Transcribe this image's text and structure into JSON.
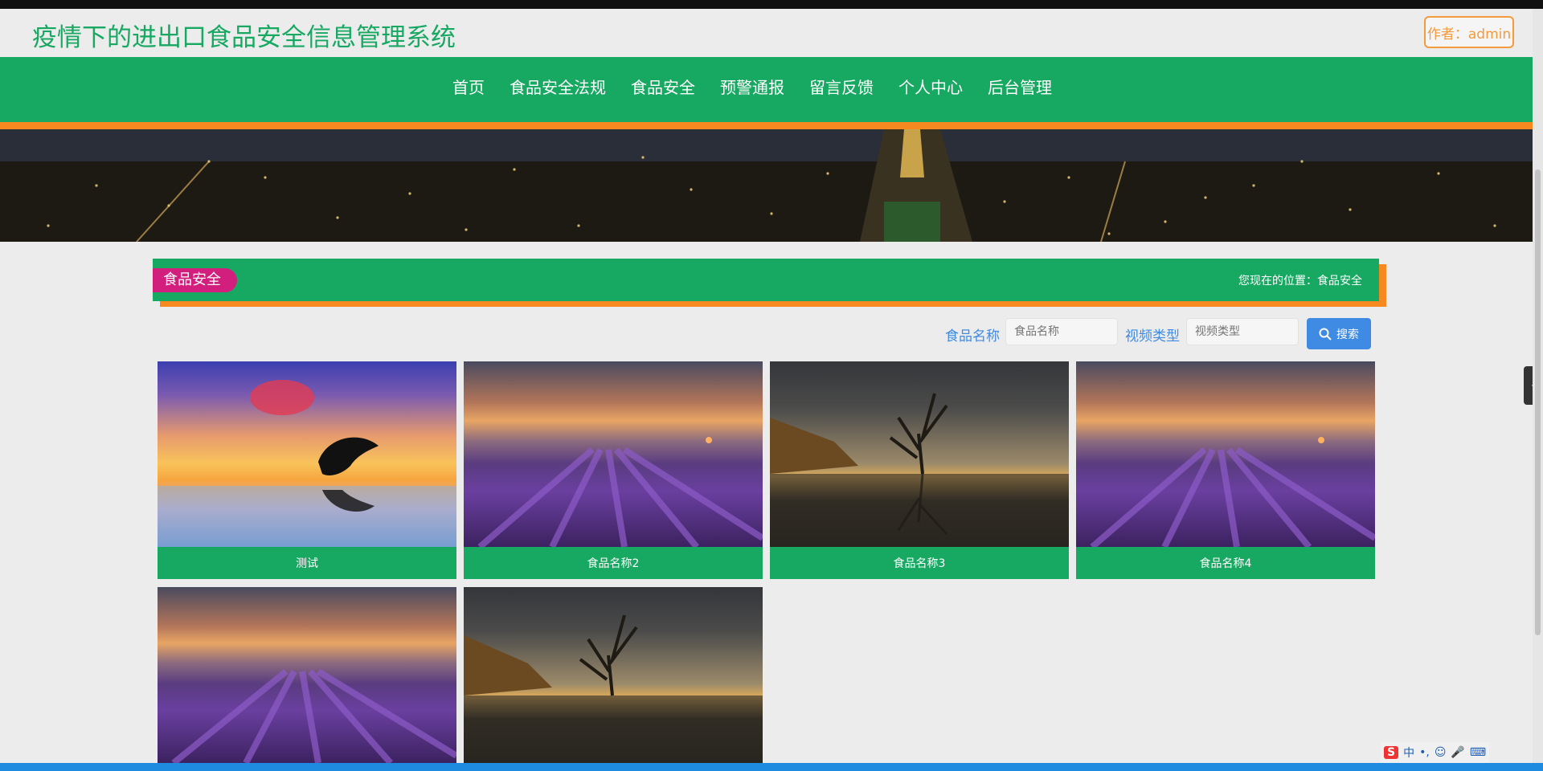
{
  "header": {
    "title": "疫情下的进出口食品安全信息管理系统",
    "author_button": "作者：admin"
  },
  "nav": {
    "items": [
      "首页",
      "食品安全法规",
      "食品安全",
      "预警通报",
      "留言反馈",
      "个人中心",
      "后台管理"
    ]
  },
  "section": {
    "title": "食品安全",
    "breadcrumb": "您现在的位置：食品安全"
  },
  "search": {
    "name_label": "食品名称",
    "name_placeholder": "食品名称",
    "type_label": "视频类型",
    "type_placeholder": "视频类型",
    "button_label": "搜索"
  },
  "cards": [
    {
      "caption": "测试",
      "image": "sunset-dolphin"
    },
    {
      "caption": "食品名称2",
      "image": "lavender-field"
    },
    {
      "caption": "食品名称3",
      "image": "lone-tree-lake"
    },
    {
      "caption": "食品名称4",
      "image": "lavender-field"
    },
    {
      "caption": "",
      "image": "lavender-field"
    },
    {
      "caption": "",
      "image": "lone-tree-lake"
    }
  ],
  "ime": {
    "logo": "S",
    "mode": "中"
  },
  "colors": {
    "primary_green": "#17a862",
    "accent_orange": "#f6891f",
    "tag_magenta": "#d21e7d",
    "link_blue": "#3f8be3"
  }
}
